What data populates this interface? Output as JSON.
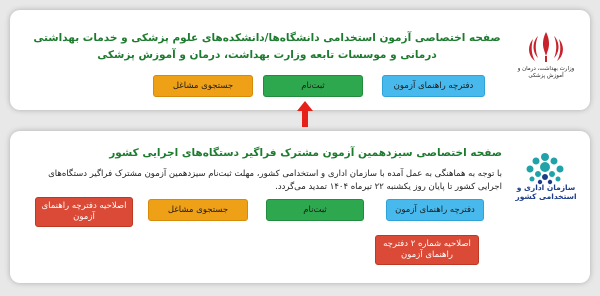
{
  "section1": {
    "title": "صفحه اختصاصی آزمون استخدامی دانشگاه‌ها/دانشکده‌های علوم پزشکی و خدمات بهداشتی درمانی و موسسات تابعه وزارت بهداشت، درمان و آموزش پزشکی",
    "logo_text": "وزارت بهداشت، درمان و آموزش پزشکی",
    "buttons": {
      "guide": "دفترچه راهنمای آزمون",
      "register": "ثبت‌نام",
      "job_search": "جستجوی مشاغل"
    }
  },
  "section2": {
    "title": "صفحه اختصاصی سیزدهمین آزمون مشترک فراگیر دستگاه‌های اجرایی کشور",
    "description": "با توجه به هماهنگی به عمل آمده با سازمان اداری و استخدامی کشور، مهلت ثبت‌نام سیزدهمین آزمون مشترک فراگیر دستگاه‌های اجرایی کشور تا پایان روز یکشنبه ۲۲ تیرماه ۱۴۰۴ تمدید می‌گردد.",
    "logo_text": "سازمان اداری و استخدامی کشور",
    "buttons": {
      "guide": "دفترچه راهنمای آزمون",
      "register": "ثبت‌نام",
      "job_search": "جستجوی مشاغل",
      "correction": "اصلاحیه دفترچه راهنمای آزمون",
      "correction2": "اصلاحیه شماره ۲ دفترچه راهنمای آزمون"
    }
  },
  "colors": {
    "title_green": "#1c7b2e",
    "blue": "#47b9ec",
    "green": "#2ea84e",
    "orange": "#eea017",
    "red": "#db4a36",
    "arrow": "#e8201a"
  }
}
